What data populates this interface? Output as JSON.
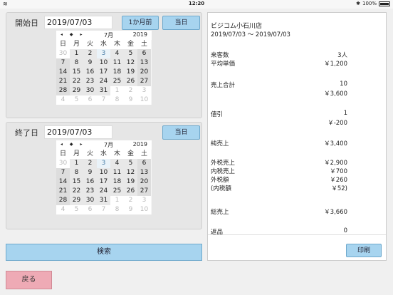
{
  "statusbar": {
    "time": "12:20",
    "battery": "100%"
  },
  "start": {
    "label": "開始日",
    "value": "2019/07/03",
    "month_button": "1か月前",
    "today_button": "当日",
    "calendar": {
      "nav": "◂ ◆ ▸",
      "month": "7月",
      "year": "2019",
      "weekdays": [
        "日",
        "月",
        "火",
        "水",
        "木",
        "金",
        "土"
      ],
      "days": [
        "30",
        "1",
        "2",
        "3",
        "4",
        "5",
        "6",
        "7",
        "8",
        "9",
        "10",
        "11",
        "12",
        "13",
        "14",
        "15",
        "16",
        "17",
        "18",
        "19",
        "20",
        "21",
        "22",
        "23",
        "24",
        "25",
        "26",
        "27",
        "28",
        "29",
        "30",
        "31",
        "1",
        "2",
        "3",
        "4",
        "5",
        "6",
        "7",
        "8",
        "9",
        "10"
      ]
    }
  },
  "end": {
    "label": "終了日",
    "value": "2019/07/03",
    "today_button": "当日",
    "calendar": {
      "nav": "◂ ◆ ▸",
      "month": "7月",
      "year": "2019",
      "weekdays": [
        "日",
        "月",
        "火",
        "水",
        "木",
        "金",
        "土"
      ],
      "days": [
        "30",
        "1",
        "2",
        "3",
        "4",
        "5",
        "6",
        "7",
        "8",
        "9",
        "10",
        "11",
        "12",
        "13",
        "14",
        "15",
        "16",
        "17",
        "18",
        "19",
        "20",
        "21",
        "22",
        "23",
        "24",
        "25",
        "26",
        "27",
        "28",
        "29",
        "30",
        "31",
        "1",
        "2",
        "3",
        "4",
        "5",
        "6",
        "7",
        "8",
        "9",
        "10"
      ]
    }
  },
  "search_button": "検索",
  "back_button": "戻る",
  "receipt": {
    "shop": "ビジコム小石川店",
    "period": "2019/07/03 〜 2019/07/03",
    "lines": [
      {
        "label": "来客数",
        "value": "3人"
      },
      {
        "label": "平均単価",
        "value": "￥1,200"
      },
      {
        "label": "売上合計",
        "value": "10"
      },
      {
        "label": "",
        "value": "￥3,600"
      },
      {
        "label": "値引",
        "value": "1"
      },
      {
        "label": "",
        "value": "￥-200"
      },
      {
        "label": "純売上",
        "value": "￥3,400"
      },
      {
        "label": "外税売上",
        "value": "￥2,900"
      },
      {
        "label": "内税売上",
        "value": "￥700"
      },
      {
        "label": "外税額",
        "value": "￥260"
      },
      {
        "label": "(内税額",
        "value": "￥52)"
      },
      {
        "label": "総売上",
        "value": "￥3,660"
      },
      {
        "label": "返品",
        "value": "0"
      }
    ],
    "print_button": "印刷"
  }
}
